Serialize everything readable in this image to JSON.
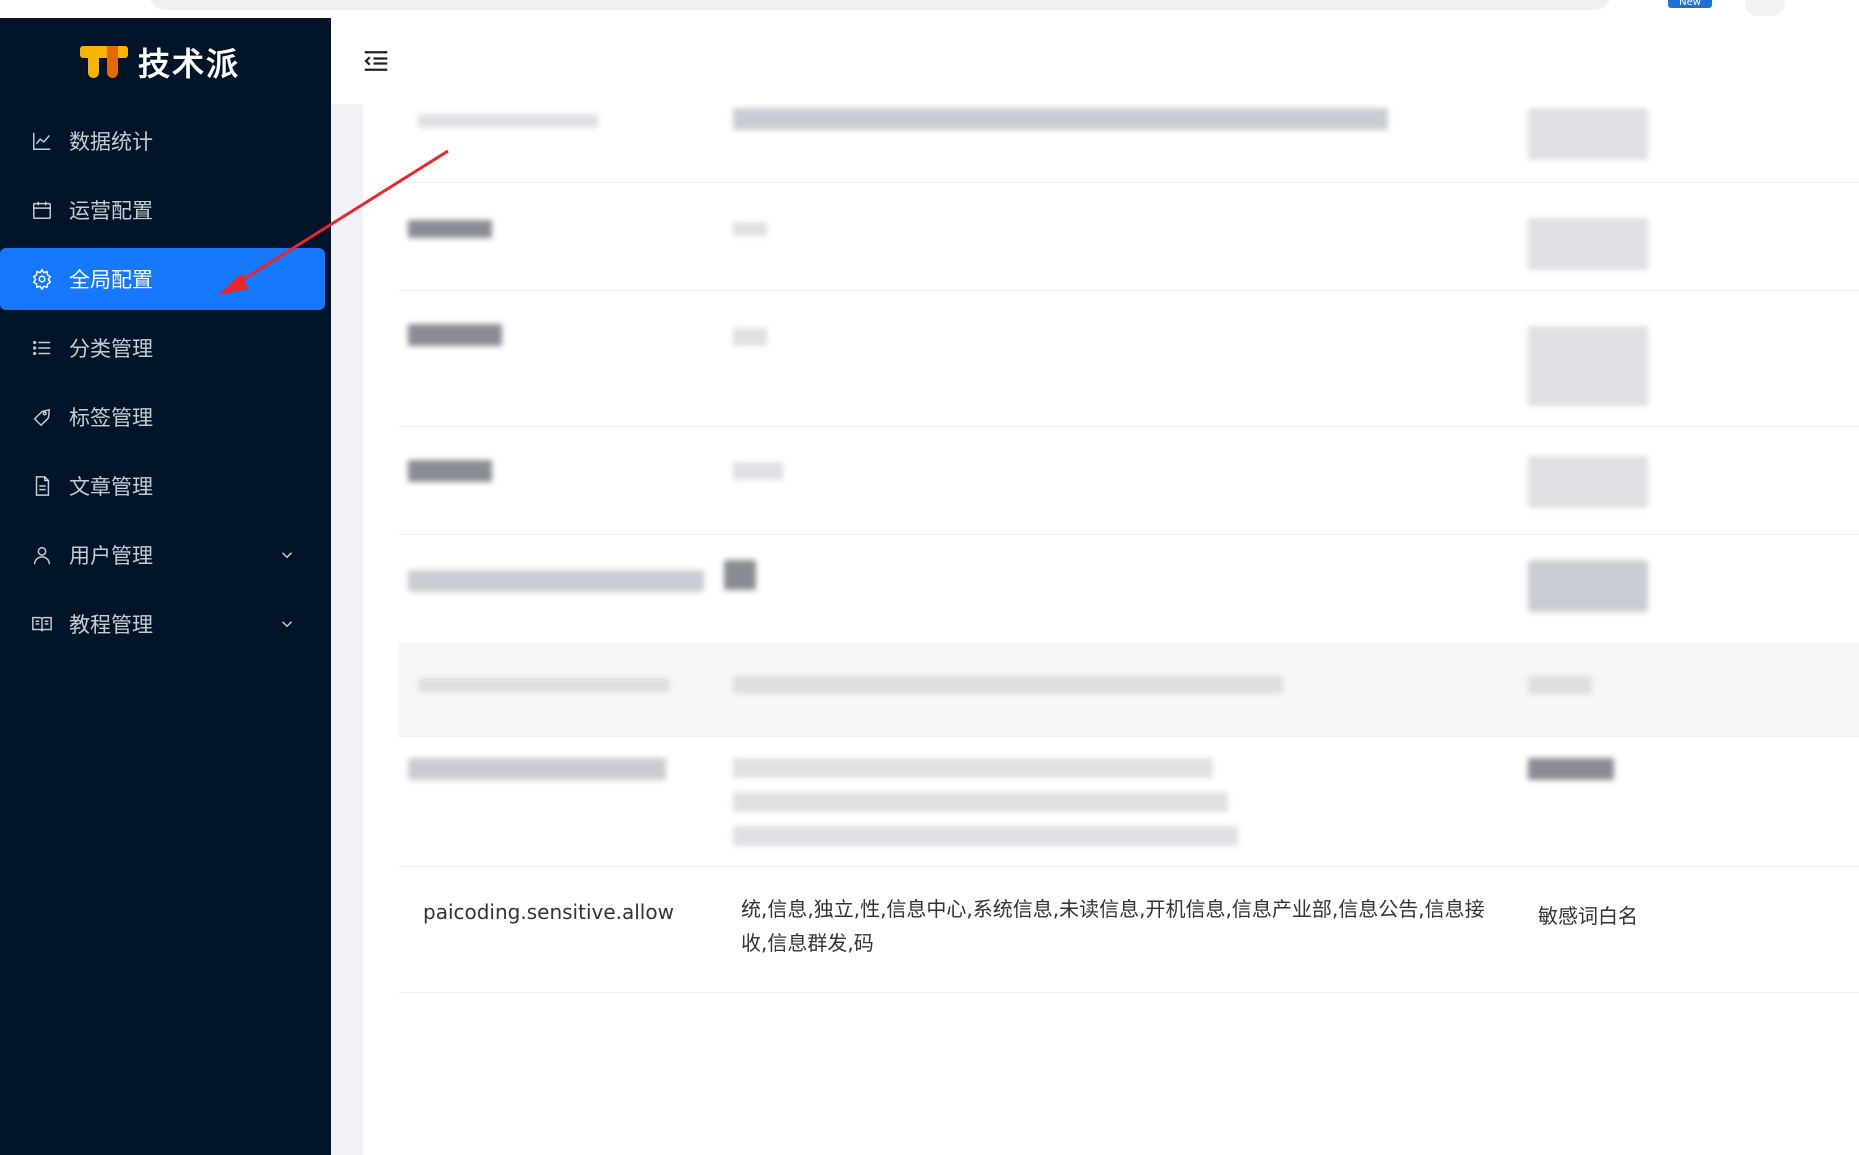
{
  "browser": {
    "badge": "New"
  },
  "app": {
    "name": "技术派"
  },
  "sidebar": {
    "items": [
      {
        "label": "数据统计",
        "icon": "line-chart-icon"
      },
      {
        "label": "运营配置",
        "icon": "calendar-icon"
      },
      {
        "label": "全局配置",
        "icon": "gear-icon",
        "active": true
      },
      {
        "label": "分类管理",
        "icon": "list-icon"
      },
      {
        "label": "标签管理",
        "icon": "tag-icon"
      },
      {
        "label": "文章管理",
        "icon": "document-icon"
      },
      {
        "label": "用户管理",
        "icon": "user-icon",
        "expandable": true
      },
      {
        "label": "教程管理",
        "icon": "book-icon",
        "expandable": true
      }
    ]
  },
  "header": {
    "collapse_icon": "menu-fold-icon"
  },
  "table": {
    "visible_row": {
      "key": "paicoding.sensitive.allow",
      "value": "统,信息,独立,性,信息中心,系统信息,未读信息,开机信息,信息产业部,信息公告,信息接收,信息群发,码",
      "description": "敏感词白名"
    }
  },
  "colors": {
    "sidebar": "#001529",
    "active": "#1677ff",
    "arrow": "#e8272b"
  }
}
